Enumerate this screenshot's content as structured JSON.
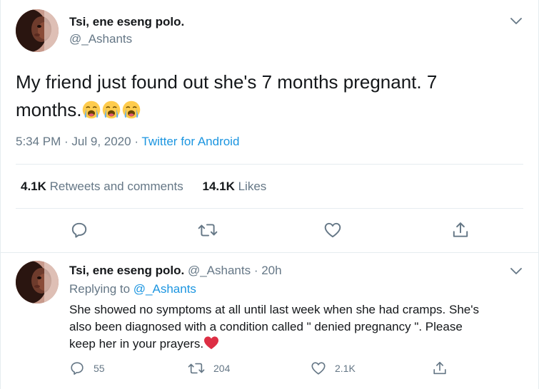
{
  "main_tweet": {
    "author_name": "Tsi, ene eseng polo.",
    "author_handle": "@_Ashants",
    "text_line1": "My friend just found out she's 7 months pregnant.  7",
    "text_line2": "months.",
    "emojis": [
      "loudly-crying-face",
      "loudly-crying-face",
      "loudly-crying-face"
    ],
    "time": "5:34 PM · Jul 9, 2020 · ",
    "source": "Twitter for Android",
    "retweets_count": "4.1K",
    "retweets_label": "Retweets and comments",
    "likes_count": "14.1K",
    "likes_label": "Likes",
    "actions": [
      "reply-icon",
      "retweet-icon",
      "like-icon",
      "share-icon"
    ]
  },
  "reply_tweet": {
    "author_name": "Tsi, ene eseng polo.",
    "author_handle": "@_Ashants",
    "time": "· 20h",
    "replying_prefix": "Replying to ",
    "replying_to": "@_Ashants",
    "text_line1": "She showed no symptoms at all until last week when she had cramps.  She's",
    "text_line2": "also been diagnosed with a condition called \" denied pregnancy \". Please",
    "text_line3": "keep her in your prayers.",
    "trailing_emoji": "red-heart",
    "reply_count": "55",
    "retweet_count": "204",
    "like_count": "2.1K"
  },
  "colors": {
    "text": "#14171a",
    "secondary": "#657786",
    "link": "#1b95e0",
    "border": "#e6ecf0",
    "heart": "#e0245e"
  }
}
